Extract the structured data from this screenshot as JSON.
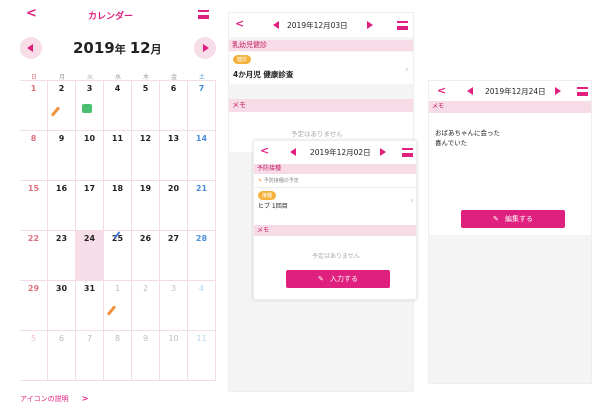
{
  "colors": {
    "accent": "#e0207e",
    "section_bg": "#f7dbe6",
    "today_bg": "#f6dde8"
  },
  "calendar": {
    "back_glyph": "<",
    "title": "カレンダー",
    "year": "2019",
    "year_suffix": "年",
    "month": "12",
    "month_suffix": "月",
    "weekdays": [
      "日",
      "月",
      "火",
      "水",
      "木",
      "金",
      "土"
    ],
    "weeks": [
      [
        "1",
        "2",
        "3",
        "4",
        "5",
        "6",
        "7"
      ],
      [
        "8",
        "9",
        "10",
        "11",
        "12",
        "13",
        "14"
      ],
      [
        "15",
        "16",
        "17",
        "18",
        "19",
        "20",
        "21"
      ],
      [
        "22",
        "23",
        "24",
        "25",
        "26",
        "27",
        "28"
      ],
      [
        "29",
        "30",
        "31",
        "1",
        "2",
        "3",
        "4"
      ],
      [
        "5",
        "6",
        "7",
        "8",
        "9",
        "10",
        "11"
      ]
    ],
    "icon_legend": "アイコンの説明",
    "icon_legend_arrow": ">"
  },
  "day1": {
    "date": "2019年12月03日",
    "section_schedule": "乳幼児健診",
    "tag": "健診",
    "event": "4か月児 健康診査",
    "section_memo": "メモ",
    "empty": "予定はありません"
  },
  "day2": {
    "date": "2019年12月02日",
    "section_schedule": "予防接種",
    "sub": "予防接種の予定",
    "tag": "接種",
    "event": "ヒブ 1回目",
    "section_memo": "メモ",
    "empty": "予定はありません",
    "button": "入力する"
  },
  "day3": {
    "date": "2019年12月24日",
    "section_memo": "メモ",
    "memo_line1": "おばあちゃんに会った",
    "memo_line2": "喜んでいた",
    "button": "編集する"
  }
}
